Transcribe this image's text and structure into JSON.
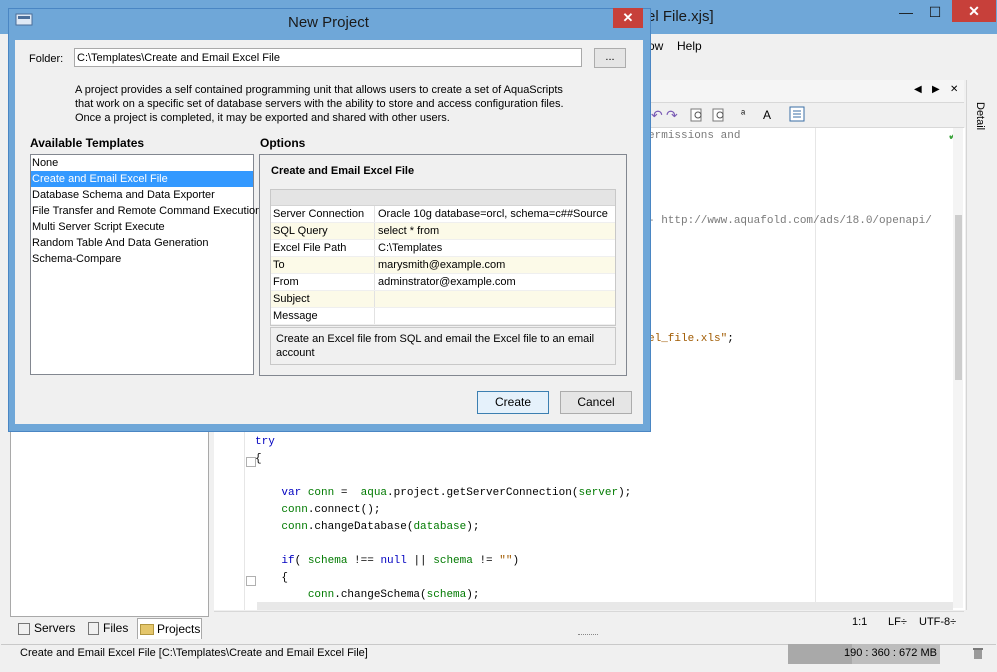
{
  "main_window": {
    "title_fragment": "el File.xjs]",
    "menu": [
      "ow",
      "Help"
    ],
    "editor_tab_nav": [
      "◀",
      "▶",
      "✕"
    ],
    "right_panel_label": "Detail",
    "code_lines": [
      {
        "segments": [
          {
            "t": "ermissions and",
            "c": "gray"
          }
        ]
      },
      {
        "segments": [
          {
            "t": "- http://www.aquafold.com/ads/18.0/openapi/",
            "c": "gray"
          }
        ]
      },
      {
        "segments": [
          {
            "t": "el_file.xls\"",
            "c": "str"
          },
          {
            "t": ";",
            "c": ""
          }
        ]
      },
      {
        "segments": [
          {
            "t": "try",
            "c": "kw"
          }
        ]
      },
      {
        "segments": [
          {
            "t": "{",
            "c": ""
          }
        ]
      },
      {
        "segments": [
          {
            "t": "    var ",
            "c": "kw"
          },
          {
            "t": "conn",
            "c": "var"
          },
          {
            "t": " =  ",
            "c": ""
          },
          {
            "t": "aqua",
            "c": "var"
          },
          {
            "t": ".project.getServerConnection(",
            "c": ""
          },
          {
            "t": "server",
            "c": "var"
          },
          {
            "t": ");",
            "c": ""
          }
        ]
      },
      {
        "segments": [
          {
            "t": "    ",
            "c": ""
          },
          {
            "t": "conn",
            "c": "var"
          },
          {
            "t": ".connect();",
            "c": ""
          }
        ]
      },
      {
        "segments": [
          {
            "t": "    ",
            "c": ""
          },
          {
            "t": "conn",
            "c": "var"
          },
          {
            "t": ".changeDatabase(",
            "c": ""
          },
          {
            "t": "database",
            "c": "var"
          },
          {
            "t": ");",
            "c": ""
          }
        ]
      },
      {
        "segments": [
          {
            "t": "    if",
            "c": "kw"
          },
          {
            "t": "( ",
            "c": ""
          },
          {
            "t": "schema",
            "c": "var"
          },
          {
            "t": " !== ",
            "c": ""
          },
          {
            "t": "null",
            "c": "kw"
          },
          {
            "t": " || ",
            "c": ""
          },
          {
            "t": "schema",
            "c": "var"
          },
          {
            "t": " != ",
            "c": ""
          },
          {
            "t": "\"\"",
            "c": "str"
          },
          {
            "t": ")",
            "c": ""
          }
        ]
      },
      {
        "segments": [
          {
            "t": "    {",
            "c": ""
          }
        ]
      },
      {
        "segments": [
          {
            "t": "        ",
            "c": ""
          },
          {
            "t": "conn",
            "c": "var"
          },
          {
            "t": ".changeSchema(",
            "c": ""
          },
          {
            "t": "schema",
            "c": "var"
          },
          {
            "t": ");",
            "c": ""
          }
        ]
      }
    ],
    "left_tabs": {
      "servers": "Servers",
      "files": "Files",
      "projects": "Projects"
    },
    "editor_status": {
      "position": "1:1",
      "line_ending": "LF÷",
      "encoding": "UTF-8÷"
    },
    "status_text": "Create and Email Excel File [C:\\Templates\\Create and Email Excel File]",
    "memory": "190 : 360 : 672 MB",
    "memory_used_fraction": 0.42
  },
  "dialog": {
    "title": "New Project",
    "close": "✕",
    "folder_label": "Folder:",
    "folder_value": "C:\\Templates\\Create and Email Excel File",
    "browse_label": "...",
    "description": [
      "A project provides a self contained programming unit that allows users to create a set of AquaScripts",
      "that work on a specific set of database servers with the ability to store and access configuration files.",
      "Once a project is completed, it may be exported and shared with other users."
    ],
    "available_templates_label": "Available Templates",
    "templates": [
      "None",
      "Create and Email Excel File",
      "Database Schema and Data Exporter",
      "File Transfer and Remote Command Execution",
      "Multi Server Script Execute",
      "Random Table And Data Generation",
      "Schema-Compare"
    ],
    "selected_template_index": 1,
    "options_label": "Options",
    "options_title": "Create and Email Excel File",
    "options": [
      {
        "key": "Server Connection",
        "value": "Oracle 10g database=orcl, schema=c##Source"
      },
      {
        "key": "SQL Query",
        "value": "select * from"
      },
      {
        "key": "Excel File Path",
        "value": "C:\\Templates"
      },
      {
        "key": "To",
        "value": "marysmith@example.com"
      },
      {
        "key": "From",
        "value": "adminstrator@example.com"
      },
      {
        "key": "Subject",
        "value": ""
      },
      {
        "key": "Message",
        "value": ""
      }
    ],
    "options_description": "Create an Excel file from SQL and email the Excel file to an email account",
    "create_button": "Create",
    "cancel_button": "Cancel"
  }
}
